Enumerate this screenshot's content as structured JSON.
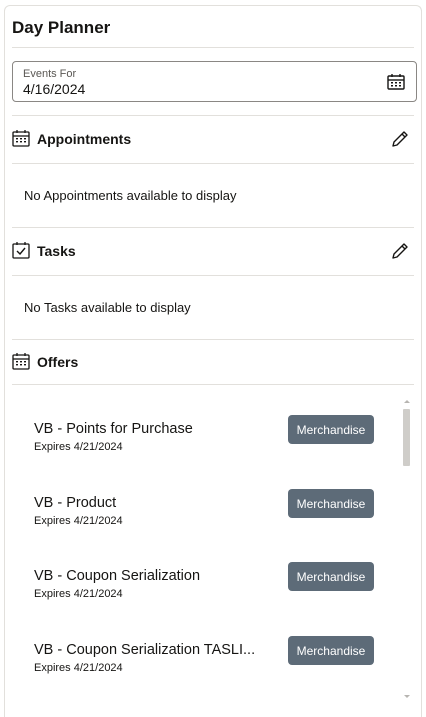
{
  "header": {
    "title": "Day Planner"
  },
  "events_for": {
    "label": "Events For",
    "value": "4/16/2024",
    "icon": "calendar-icon"
  },
  "appointments": {
    "title": "Appointments",
    "empty_message": "No Appointments available to display",
    "icon": "calendar-icon",
    "edit_icon": "pencil-icon"
  },
  "tasks": {
    "title": "Tasks",
    "empty_message": "No Tasks available to display",
    "icon": "calendar-check-icon",
    "edit_icon": "pencil-icon"
  },
  "offers": {
    "title": "Offers",
    "icon": "calendar-icon",
    "items": [
      {
        "name": "VB - Points for Purchase",
        "expires": "Expires 4/21/2024",
        "category": "Merchandise"
      },
      {
        "name": "VB - Product",
        "expires": "Expires 4/21/2024",
        "category": "Merchandise"
      },
      {
        "name": "VB - Coupon Serialization",
        "expires": "Expires 4/21/2024",
        "category": "Merchandise"
      },
      {
        "name": "VB - Coupon Serialization TASLI...",
        "expires": "Expires 4/21/2024",
        "category": "Merchandise"
      }
    ]
  },
  "colors": {
    "button_bg": "#5d6b78",
    "divider": "#e2e0dc",
    "text": "#161513"
  }
}
